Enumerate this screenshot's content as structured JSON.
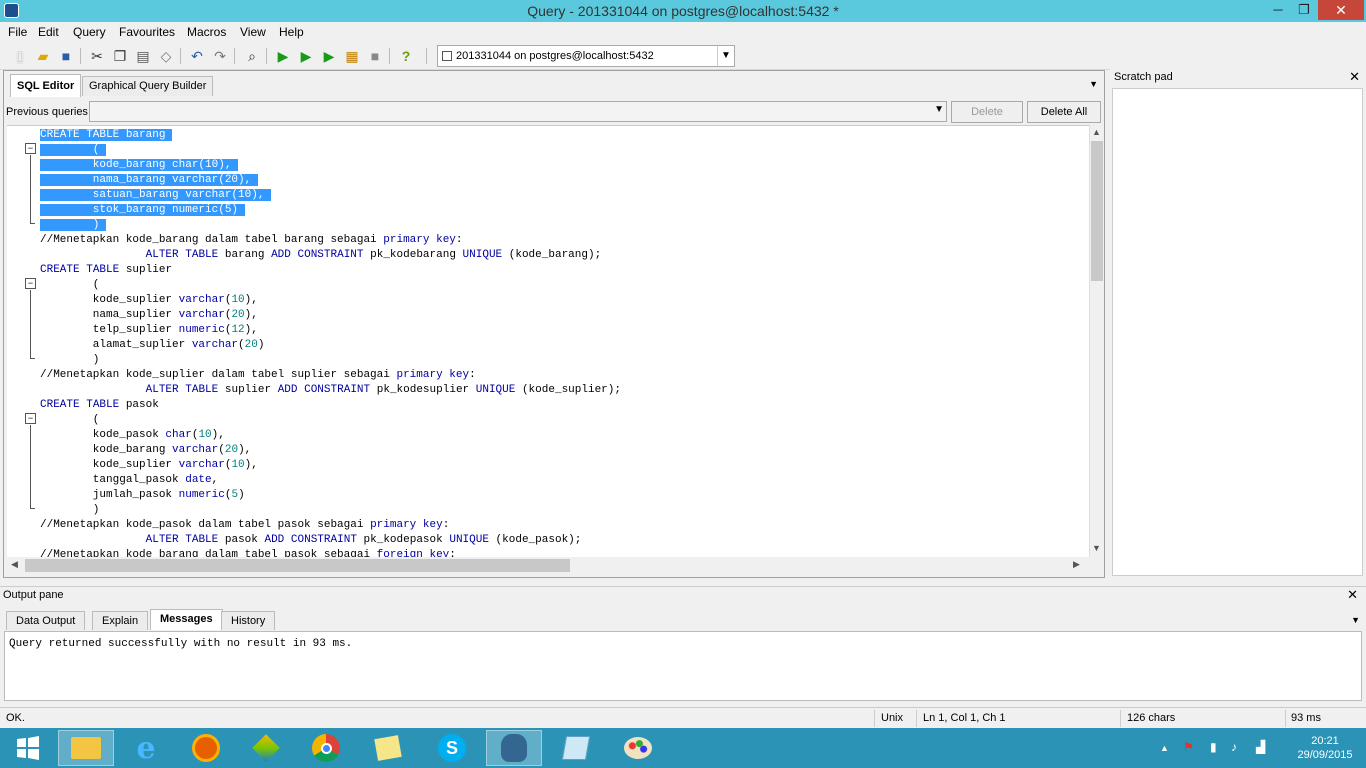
{
  "window": {
    "title": "Query - 201331044 on postgres@localhost:5432 *",
    "minimize": "─",
    "maximize": "❐",
    "close": "✕"
  },
  "menu": [
    "File",
    "Edit",
    "Query",
    "Favourites",
    "Macros",
    "View",
    "Help"
  ],
  "toolbar": {
    "connection": "201331044 on postgres@localhost:5432"
  },
  "editor_tabs": [
    "SQL Editor",
    "Graphical Query Builder"
  ],
  "previous_queries": {
    "label": "Previous queries",
    "value": "",
    "delete": "Delete",
    "delete_all": "Delete All"
  },
  "code": [
    "CREATE TABLE barang",
    "        (",
    "        kode_barang char(10),",
    "        nama_barang varchar(20),",
    "        satuan_barang varchar(10),",
    "        stok_barang numeric(5)",
    "        )",
    "//Menetapkan kode_barang dalam tabel barang sebagai primary key:",
    "                ALTER TABLE barang ADD CONSTRAINT pk_kodebarang UNIQUE (kode_barang);",
    "CREATE TABLE suplier",
    "        (",
    "        kode_suplier varchar(10),",
    "        nama_suplier varchar(20),",
    "        telp_suplier numeric(12),",
    "        alamat_suplier varchar(20)",
    "        )",
    "//Menetapkan kode_suplier dalam tabel suplier sebagai primary key:",
    "                ALTER TABLE suplier ADD CONSTRAINT pk_kodesuplier UNIQUE (kode_suplier);",
    "CREATE TABLE pasok",
    "        (",
    "        kode_pasok char(10),",
    "        kode_barang varchar(20),",
    "        kode_suplier varchar(10),",
    "        tanggal_pasok date,",
    "        jumlah_pasok numeric(5)",
    "        )",
    "//Menetapkan kode_pasok dalam tabel pasok sebagai primary key:",
    "                ALTER TABLE pasok ADD CONSTRAINT pk_kodepasok UNIQUE (kode_pasok);",
    "//Menetapkan kode_barang dalam tabel pasok sebagai foreign key:"
  ],
  "selected_lines": 7,
  "scratch_pad": {
    "title": "Scratch pad",
    "close": "✕"
  },
  "output": {
    "title": "Output pane",
    "close": "✕",
    "tabs": [
      "Data Output",
      "Explain",
      "Messages",
      "History"
    ],
    "active_tab": "Messages",
    "message": "Query returned successfully with no result in 93 ms."
  },
  "status": {
    "state": "OK.",
    "encoding": "Unix",
    "position": "Ln 1, Col 1, Ch 1",
    "chars": "126 chars",
    "time": "93 ms"
  },
  "clock": {
    "time": "20:21",
    "date": "29/09/2015"
  },
  "colors": {
    "titlebar": "#5bc9dd",
    "taskbar": "#2b93b6",
    "selection": "#3399ff",
    "close": "#c7463a"
  }
}
